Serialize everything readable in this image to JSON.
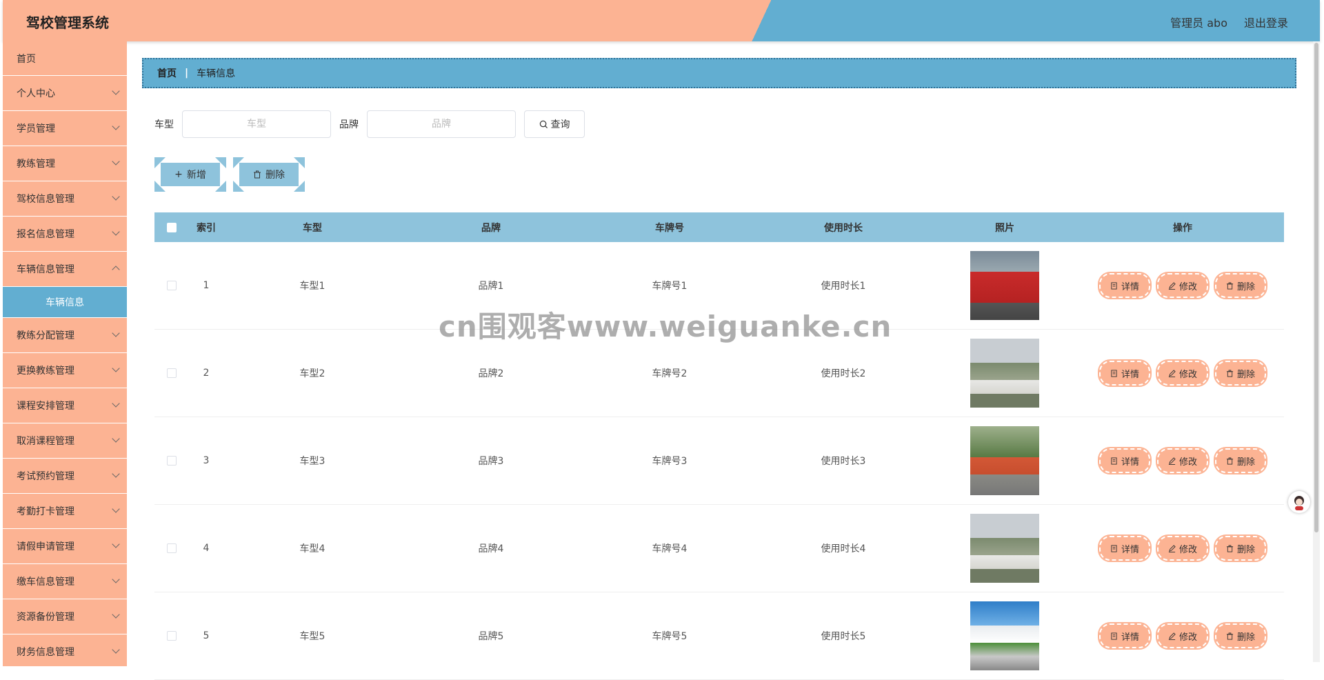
{
  "header": {
    "title": "驾校管理系统",
    "user": "管理员 abo",
    "logout": "退出登录"
  },
  "sidebar": {
    "items": [
      {
        "label": "首页"
      },
      {
        "label": "个人中心"
      },
      {
        "label": "学员管理"
      },
      {
        "label": "教练管理"
      },
      {
        "label": "驾校信息管理"
      },
      {
        "label": "报名信息管理"
      },
      {
        "label": "车辆信息管理"
      },
      {
        "label": "车辆信息"
      },
      {
        "label": "教练分配管理"
      },
      {
        "label": "更换教练管理"
      },
      {
        "label": "课程安排管理"
      },
      {
        "label": "取消课程管理"
      },
      {
        "label": "考试预约管理"
      },
      {
        "label": "考勤打卡管理"
      },
      {
        "label": "请假申请管理"
      },
      {
        "label": "缴车信息管理"
      },
      {
        "label": "资源备份管理"
      },
      {
        "label": "财务信息管理"
      }
    ]
  },
  "breadcrumb": {
    "home": "首页",
    "sep": "|",
    "current": "车辆信息"
  },
  "search": {
    "type_label": "车型",
    "type_placeholder": "车型",
    "brand_label": "品牌",
    "brand_placeholder": "品牌",
    "query_label": "查询"
  },
  "actions": {
    "add": "新增",
    "delete": "删除"
  },
  "table": {
    "headers": {
      "index": "索引",
      "type": "车型",
      "brand": "品牌",
      "plate": "车牌号",
      "duration": "使用时长",
      "photo": "照片",
      "ops": "操作"
    },
    "ops": {
      "detail": "详情",
      "edit": "修改",
      "delete": "删除"
    },
    "rows": [
      {
        "index": "1",
        "type": "车型1",
        "brand": "品牌1",
        "plate": "车牌号1",
        "duration": "使用时长1"
      },
      {
        "index": "2",
        "type": "车型2",
        "brand": "品牌2",
        "plate": "车牌号2",
        "duration": "使用时长2"
      },
      {
        "index": "3",
        "type": "车型3",
        "brand": "品牌3",
        "plate": "车牌号3",
        "duration": "使用时长3"
      },
      {
        "index": "4",
        "type": "车型4",
        "brand": "品牌4",
        "plate": "车牌号4",
        "duration": "使用时长4"
      },
      {
        "index": "5",
        "type": "车型5",
        "brand": "品牌5",
        "plate": "车牌号5",
        "duration": "使用时长5"
      }
    ]
  },
  "watermark": "cn围观客www.weiguanke.cn",
  "colors": {
    "peach": "#fcb393",
    "blue": "#62aed1",
    "table_head": "#8ec3dc"
  }
}
